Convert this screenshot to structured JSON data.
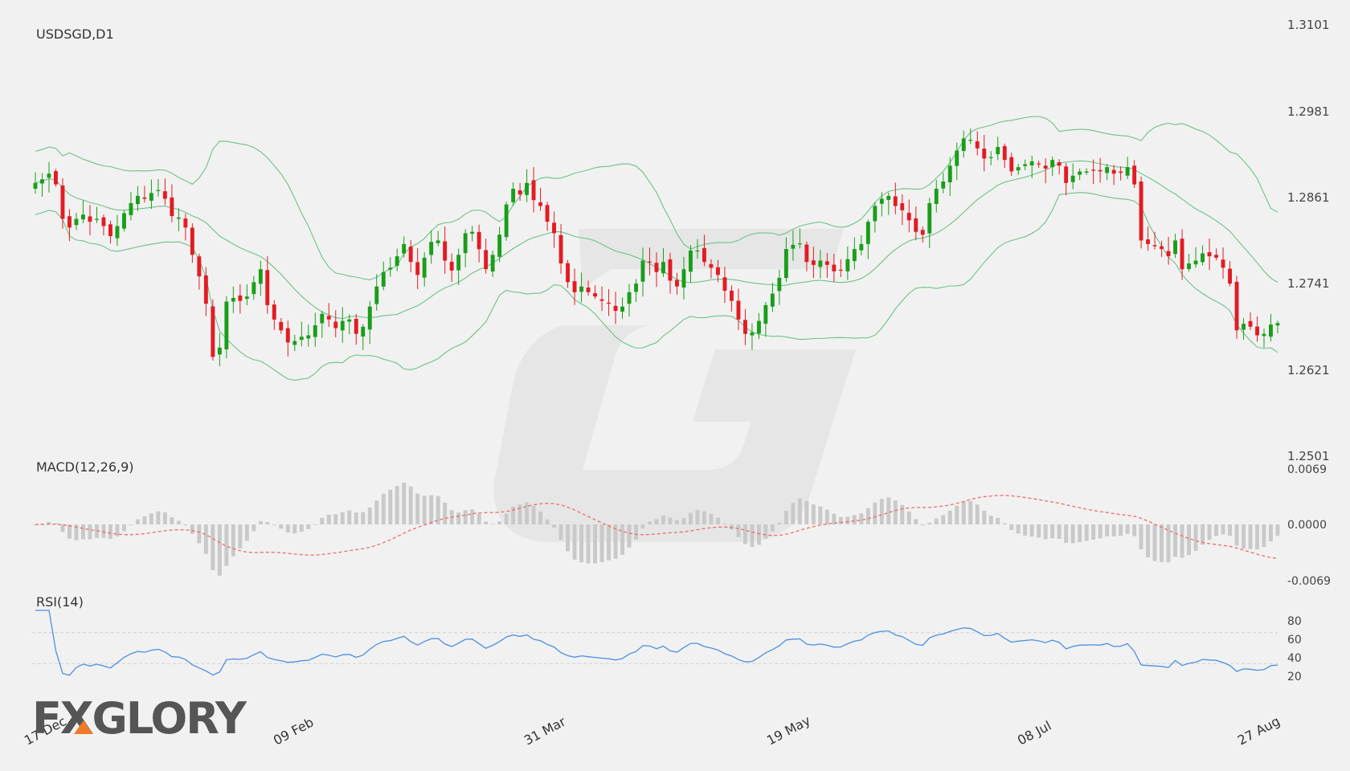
{
  "brand": {
    "logo_text": "FXGLORY"
  },
  "chart_data": [
    {
      "type": "candlestick",
      "title": "USDSGD,D1",
      "ylim": [
        1.2501,
        1.3101
      ],
      "yticks": [
        "1.3101",
        "1.2981",
        "1.2861",
        "1.2741",
        "1.2621",
        "1.2501"
      ],
      "xticks": [
        "17 Dec",
        "09 Feb",
        "31 Mar",
        "19 May",
        "08 Jul",
        "27 Aug"
      ],
      "indicator": "Bollinger Bands",
      "close": [
        1.288,
        1.2885,
        1.2893,
        1.2878,
        1.283,
        1.2818,
        1.283,
        1.2836,
        1.2826,
        1.283,
        1.282,
        1.2806,
        1.282,
        1.2838,
        1.2852,
        1.2862,
        1.2858,
        1.2866,
        1.287,
        1.2858,
        1.2834,
        1.2832,
        1.2818,
        1.278,
        1.275,
        1.2712,
        1.2638,
        1.2651,
        1.2715,
        1.272,
        1.2716,
        1.2722,
        1.2742,
        1.276,
        1.271,
        1.269,
        1.2675,
        1.2658,
        1.266,
        1.2666,
        1.2668,
        1.2682,
        1.2698,
        1.269,
        1.2678,
        1.2688,
        1.269,
        1.267,
        1.268,
        1.2708,
        1.2736,
        1.2756,
        1.2762,
        1.2778,
        1.2795,
        1.277,
        1.2752,
        1.2776,
        1.2798,
        1.28,
        1.2772,
        1.2758,
        1.278,
        1.281,
        1.2812,
        1.2788,
        1.276,
        1.278,
        1.2808,
        1.285,
        1.2872,
        1.2864,
        1.288,
        1.2856,
        1.2848,
        1.2826,
        1.281,
        1.2768,
        1.2742,
        1.2728,
        1.2736,
        1.2728,
        1.2722,
        1.2716,
        1.2712,
        1.2702,
        1.2708,
        1.2728,
        1.274,
        1.2772,
        1.277,
        1.2756,
        1.277,
        1.2744,
        1.2736,
        1.276,
        1.2786,
        1.2786,
        1.277,
        1.2762,
        1.2752,
        1.273,
        1.2716,
        1.269,
        1.267,
        1.2672,
        1.2688,
        1.271,
        1.2726,
        1.2748,
        1.2788,
        1.2794,
        1.2796,
        1.277,
        1.2766,
        1.2772,
        1.2766,
        1.2757,
        1.2758,
        1.2774,
        1.2788,
        1.2795,
        1.2826,
        1.2848,
        1.2858,
        1.2862,
        1.2848,
        1.2842,
        1.2828,
        1.2812,
        1.2808,
        1.2852,
        1.2872,
        1.2882,
        1.2904,
        1.2925,
        1.2942,
        1.294,
        1.2928,
        1.2914,
        1.2916,
        1.293,
        1.2912,
        1.2896,
        1.2902,
        1.2906,
        1.291,
        1.2906,
        1.29,
        1.2912,
        1.2904,
        1.288,
        1.289,
        1.2896,
        1.2896,
        1.2897,
        1.2896,
        1.2902,
        1.2893,
        1.2894,
        1.2902,
        1.2878,
        1.28,
        1.2795,
        1.2792,
        1.2788,
        1.2778,
        1.28,
        1.276,
        1.2768,
        1.2772,
        1.2782,
        1.2778,
        1.2776,
        1.2762,
        1.274,
        1.2675,
        1.2684,
        1.268,
        1.2668,
        1.267,
        1.2683,
        1.2685
      ],
      "rsi_period": 14,
      "macd_params": [
        12,
        26,
        9
      ]
    },
    {
      "type": "line",
      "title": "MACD(12,26,9)",
      "yticks": [
        "0.0069",
        "0.0000",
        "-0.0069"
      ],
      "ylim": [
        -0.0069,
        0.0069
      ]
    },
    {
      "type": "line",
      "title": "RSI(14)",
      "yticks": [
        "80",
        "60",
        "40",
        "20"
      ],
      "ylim": [
        0,
        100
      ],
      "levels": [
        70,
        30
      ]
    }
  ],
  "colors": {
    "bull": "#1a9e1a",
    "bear": "#e31b23",
    "bands": "#6cc28a",
    "macd_signal": "#f06a6a",
    "histogram": "#c9c9c9",
    "rsi": "#4a90e2",
    "logo": "#555555",
    "logo_accent": "#f07a2a"
  }
}
